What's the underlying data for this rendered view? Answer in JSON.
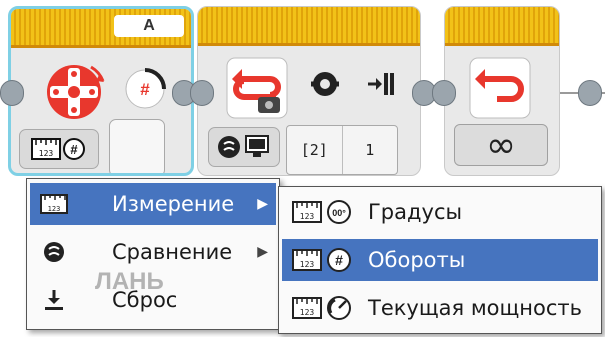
{
  "blocks": [
    {
      "name": "medium-motor-block",
      "port": "A",
      "selected": true,
      "mode_icon": "ruler-rotations-icon"
    },
    {
      "name": "loop-interrupt-block",
      "params": [
        "[2]",
        "1"
      ]
    },
    {
      "name": "loop-block",
      "loop_symbol": "∞"
    }
  ],
  "menu": {
    "items": [
      {
        "label": "Измерение",
        "icon": "ruler-icon",
        "has_submenu": true,
        "highlighted": true
      },
      {
        "label": "Сравнение",
        "icon": "compare-icon",
        "has_submenu": true,
        "highlighted": false
      },
      {
        "label": "Сброс",
        "icon": "reset-download-icon",
        "has_submenu": false,
        "highlighted": false
      }
    ]
  },
  "submenu": {
    "items": [
      {
        "label": "Градусы",
        "icon": "ruler-degrees-icon",
        "highlighted": false
      },
      {
        "label": "Обороты",
        "icon": "ruler-rotations-icon",
        "highlighted": true
      },
      {
        "label": "Текущая мощность",
        "icon": "ruler-power-icon",
        "highlighted": false
      }
    ]
  },
  "watermark": "ЛАНЬ",
  "colors": {
    "block_header": "#f2c218",
    "selection": "#7fd0e5",
    "motor_red": "#e8372d",
    "highlight": "#4674bf"
  }
}
